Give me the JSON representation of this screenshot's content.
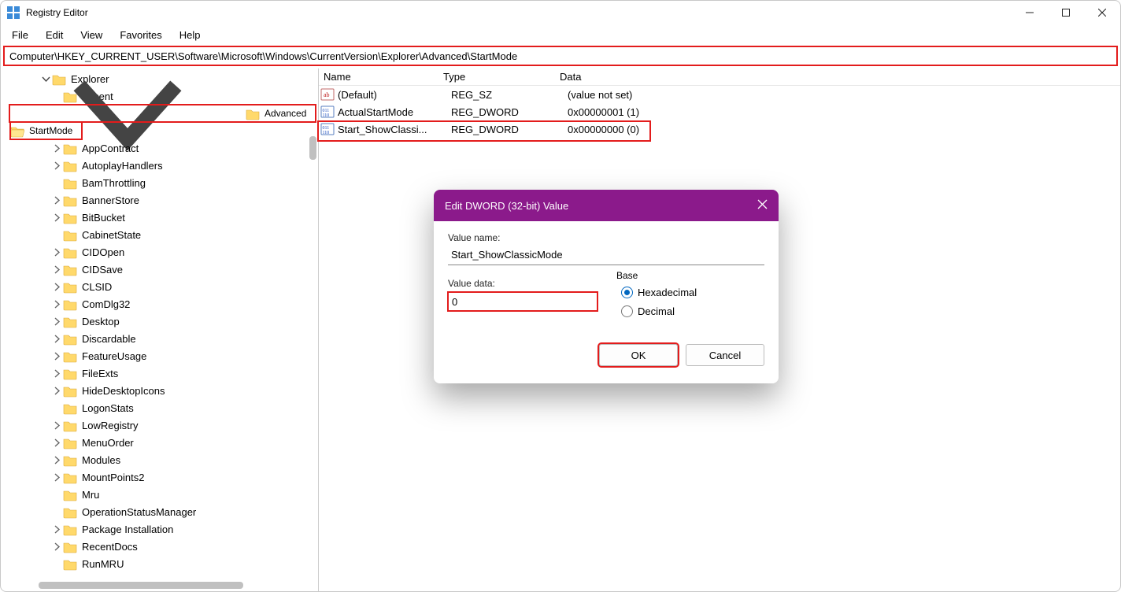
{
  "window": {
    "title": "Registry Editor"
  },
  "menu": {
    "file": "File",
    "edit": "Edit",
    "view": "View",
    "favorites": "Favorites",
    "help": "Help"
  },
  "address": "Computer\\HKEY_CURRENT_USER\\Software\\Microsoft\\Windows\\CurrentVersion\\Explorer\\Advanced\\StartMode",
  "tree": [
    {
      "label": "Explorer",
      "level": 4,
      "expanded": true,
      "hasChildren": true
    },
    {
      "label": "Accent",
      "level": 5,
      "hasChildren": false
    },
    {
      "label": "Advanced",
      "level": 5,
      "expanded": true,
      "hasChildren": true,
      "red": true
    },
    {
      "label": "StartMode",
      "level": 6,
      "hasChildren": false,
      "red": true,
      "open": true
    },
    {
      "label": "AppContract",
      "level": 5,
      "hasChildren": true
    },
    {
      "label": "AutoplayHandlers",
      "level": 5,
      "hasChildren": true
    },
    {
      "label": "BamThrottling",
      "level": 5,
      "hasChildren": false
    },
    {
      "label": "BannerStore",
      "level": 5,
      "hasChildren": true
    },
    {
      "label": "BitBucket",
      "level": 5,
      "hasChildren": true
    },
    {
      "label": "CabinetState",
      "level": 5,
      "hasChildren": false,
      "dotparent": true
    },
    {
      "label": "CIDOpen",
      "level": 5,
      "hasChildren": true
    },
    {
      "label": "CIDSave",
      "level": 5,
      "hasChildren": true
    },
    {
      "label": "CLSID",
      "level": 5,
      "hasChildren": true
    },
    {
      "label": "ComDlg32",
      "level": 5,
      "hasChildren": true
    },
    {
      "label": "Desktop",
      "level": 5,
      "hasChildren": true
    },
    {
      "label": "Discardable",
      "level": 5,
      "hasChildren": true
    },
    {
      "label": "FeatureUsage",
      "level": 5,
      "hasChildren": true
    },
    {
      "label": "FileExts",
      "level": 5,
      "hasChildren": true
    },
    {
      "label": "HideDesktopIcons",
      "level": 5,
      "hasChildren": true
    },
    {
      "label": "LogonStats",
      "level": 5,
      "hasChildren": false
    },
    {
      "label": "LowRegistry",
      "level": 5,
      "hasChildren": true
    },
    {
      "label": "MenuOrder",
      "level": 5,
      "hasChildren": true
    },
    {
      "label": "Modules",
      "level": 5,
      "hasChildren": true
    },
    {
      "label": "MountPoints2",
      "level": 5,
      "hasChildren": true
    },
    {
      "label": "Mru",
      "level": 5,
      "hasChildren": false
    },
    {
      "label": "OperationStatusManager",
      "level": 5,
      "hasChildren": false
    },
    {
      "label": "Package Installation",
      "level": 5,
      "hasChildren": true
    },
    {
      "label": "RecentDocs",
      "level": 5,
      "hasChildren": true
    },
    {
      "label": "RunMRU",
      "level": 5,
      "hasChildren": false
    }
  ],
  "list": {
    "cols": {
      "name": "Name",
      "type": "Type",
      "data": "Data"
    },
    "rows": [
      {
        "icon": "sz",
        "name": "(Default)",
        "type": "REG_SZ",
        "data": "(value not set)"
      },
      {
        "icon": "dw",
        "name": "ActualStartMode",
        "type": "REG_DWORD",
        "data": "0x00000001 (1)"
      },
      {
        "icon": "dw",
        "name": "Start_ShowClassi...",
        "type": "REG_DWORD",
        "data": "0x00000000 (0)",
        "red": true
      }
    ]
  },
  "dialog": {
    "title": "Edit DWORD (32-bit) Value",
    "valueNameLabel": "Value name:",
    "valueName": "Start_ShowClassicMode",
    "valueDataLabel": "Value data:",
    "valueData": "0",
    "baseLabel": "Base",
    "hex": "Hexadecimal",
    "dec": "Decimal",
    "ok": "OK",
    "cancel": "Cancel"
  }
}
